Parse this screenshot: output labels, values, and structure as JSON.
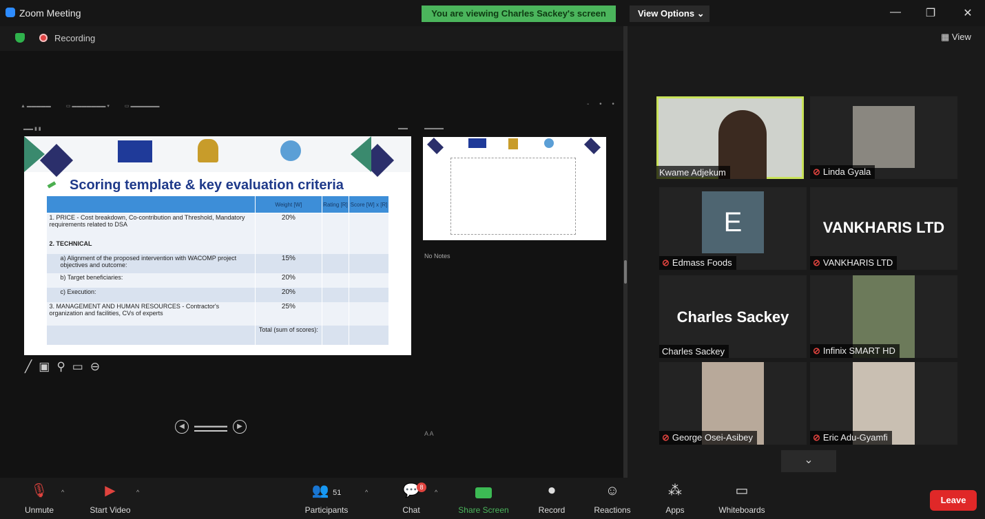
{
  "window": {
    "title": "Zoom Meeting",
    "banner": "You are viewing Charles Sackey's screen",
    "view_options": "View Options ⌄",
    "minimize": "—",
    "restore": "❐",
    "close": "✕"
  },
  "status": {
    "recording": "Recording",
    "view_label": "View"
  },
  "presentation": {
    "slide_title": "Scoring template & key evaluation criteria",
    "table_headers": [
      "",
      "Weight [W]",
      "Rating [R]",
      "Score [W] x [R]"
    ],
    "rows": [
      {
        "label": "1.  PRICE - Cost breakdown, Co-contribution and Threshold, Mandatory requirements related to DSA",
        "weight": "20%"
      },
      {
        "label": "2.  TECHNICAL",
        "weight": ""
      },
      {
        "label": "a) Alignment of the proposed intervention with WACOMP project objectives and outcome:",
        "weight": "15%"
      },
      {
        "label": "b) Target beneficiaries:",
        "weight": "20%"
      },
      {
        "label": "c) Execution:",
        "weight": "20%"
      },
      {
        "label": "3.  MANAGEMENT AND HUMAN RESOURCES - Contractor's organization and facilities, CVs of experts",
        "weight": "25%"
      },
      {
        "label": "",
        "weight": "Total (sum of scores):"
      }
    ],
    "no_notes": "No Notes"
  },
  "participants": [
    {
      "name": "Kwame Adjekum",
      "muted": false,
      "active": true
    },
    {
      "name": "Linda Gyala",
      "muted": true
    },
    {
      "name": "Edmass Foods",
      "muted": true,
      "avatar_letter": "E"
    },
    {
      "name": "VANKHARIS LTD",
      "muted": true,
      "display_text": "VANKHARIS LTD"
    },
    {
      "name": "Charles Sackey",
      "muted": false,
      "display_text": "Charles Sackey"
    },
    {
      "name": "Infinix SMART HD",
      "muted": true
    },
    {
      "name": "George Osei-Asibey",
      "muted": true
    },
    {
      "name": "Eric Adu-Gyamfi",
      "muted": true
    }
  ],
  "toolbar": {
    "unmute": "Unmute",
    "start_video": "Start Video",
    "participants": "Participants",
    "participants_count": "51",
    "chat": "Chat",
    "chat_badge": "8",
    "share_screen": "Share Screen",
    "record": "Record",
    "reactions": "Reactions",
    "apps": "Apps",
    "whiteboards": "Whiteboards",
    "leave": "Leave"
  }
}
